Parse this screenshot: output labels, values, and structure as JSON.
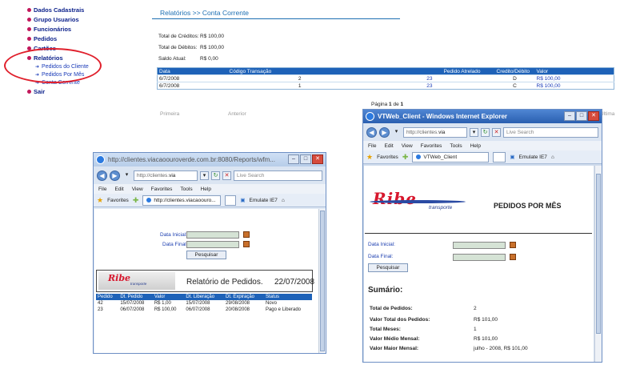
{
  "menu": {
    "items": [
      "Dados Cadastrais",
      "Grupo Usuarios",
      "Funcionários",
      "Pedidos",
      "Cartões",
      "Relatórios",
      "Sair"
    ],
    "sub_items": [
      "Pedidos do Cliente",
      "Pedidos Por Mês",
      "Conta Corrente"
    ]
  },
  "page": {
    "breadcrumb": "Relatórios  >> Conta Corrente",
    "total_creditos_label": "Total de Créditos:",
    "total_creditos": "R$ 100,00",
    "total_debitos_label": "Total de Débitos:",
    "total_debitos": "R$ 100,00",
    "saldo_label": "Saldo Atual:",
    "saldo": "R$ 0,00",
    "table": {
      "headers": [
        "Data",
        "Código Transação",
        "Pedido Atrelado",
        "Credito/Débito",
        "Valor"
      ],
      "rows": [
        [
          "6/7/2008",
          "2",
          "23",
          "D",
          "R$ 100,00"
        ],
        [
          "6/7/2008",
          "1",
          "23",
          "C",
          "R$ 100,00"
        ]
      ]
    },
    "pager_prefix": "Página ",
    "pager_current": "1",
    "pager_of": " de ",
    "pager_total": "1",
    "pager_first": "Primeira",
    "pager_prev": "Anterior",
    "pager_last": "Última"
  },
  "win1": {
    "title": "http://clientes.viacaoouroverde.com.br:8080/Reports/wfm...",
    "address_prefix": "http://clientes.",
    "address_bold": "via",
    "search_placeholder": "Live Search",
    "menu": [
      "File",
      "Edit",
      "View",
      "Favorites",
      "Tools",
      "Help"
    ],
    "favorites_label": "Favorites",
    "tab_title": "http://clientes.viacaoouro...",
    "emulate": "Emulate IE7",
    "data_inicial": "Data Inicial:",
    "data_final": "Data Final:",
    "search_button": "Pesquisar",
    "logo_name": "Ribe",
    "logo_sub": "transporte",
    "report_title": "Relatório de Pedidos.",
    "report_date": "22/07/2008",
    "orders": {
      "headers": [
        "Pedido",
        "Dt. Pedido",
        "Valor",
        "Dt. Liberação",
        "Dt. Expiração",
        "Status"
      ],
      "rows": [
        [
          "42",
          "15/07/2008",
          "R$ 1,00",
          "15/07/2008",
          "29/08/2008",
          "Novo"
        ],
        [
          "23",
          "06/07/2008",
          "R$ 100,00",
          "06/07/2008",
          "20/08/2008",
          "Pago e Liberado"
        ]
      ]
    }
  },
  "win2": {
    "title": "VTWeb_Client - Windows Internet Explorer",
    "address_prefix": "http://clientes.",
    "address_bold": "via",
    "search_placeholder": "Live Search",
    "menu": [
      "File",
      "Edit",
      "View",
      "Favorites",
      "Tools",
      "Help"
    ],
    "favorites_label": "Favorites",
    "tab_title": "VTWeb_Client",
    "emulate": "Emulate IE7",
    "logo_name": "Ribe",
    "logo_sub": "transporte",
    "report_title": "PEDIDOS POR MÊS",
    "data_inicial": "Data Inicial:",
    "data_final": "Data Final:",
    "search_button": "Pesquisar",
    "summary_title": "Sumário:",
    "summary": [
      {
        "label": "Total de Pedidos:",
        "value": "2"
      },
      {
        "label": "Valor Total dos Pedidos:",
        "value": "R$ 101,00"
      },
      {
        "label": "Total Meses:",
        "value": "1"
      },
      {
        "label": "Valor Médio Mensal:",
        "value": "R$ 101,00"
      },
      {
        "label": "Valor Maior Mensal:",
        "value": "julho - 2008, R$ 101,00"
      }
    ]
  },
  "colors": {
    "accent": "#1e62b8",
    "logo_red": "#d7172d",
    "highlight_circle": "#e0202c"
  }
}
